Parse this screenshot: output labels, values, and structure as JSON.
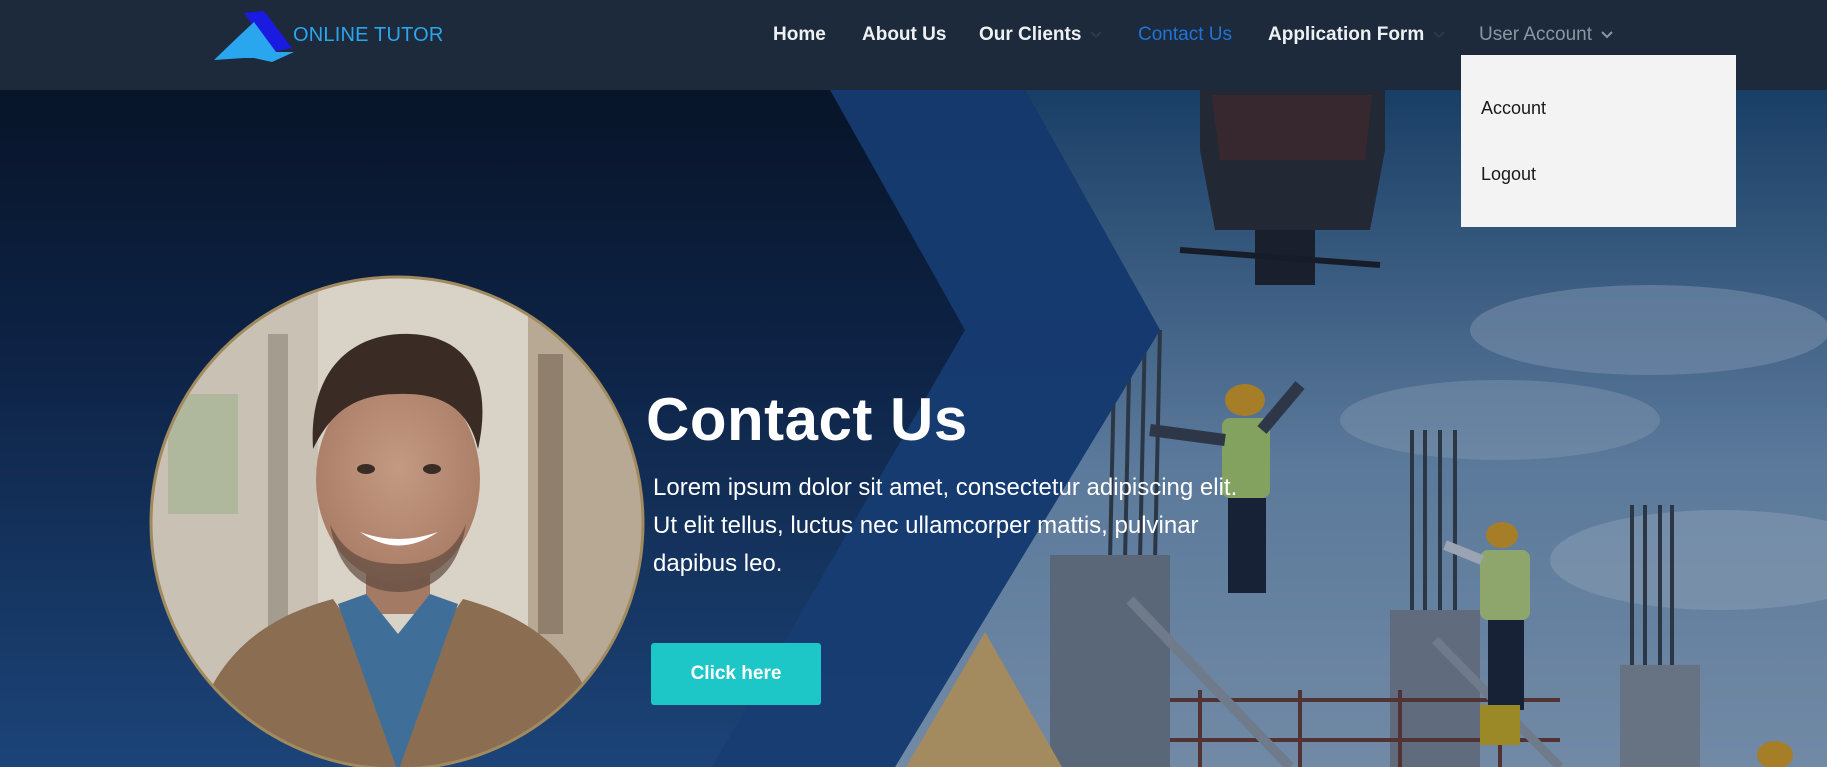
{
  "brand": {
    "name": "ONLINE TUTOR"
  },
  "nav": {
    "items": [
      {
        "label": "Home"
      },
      {
        "label": "About Us"
      },
      {
        "label": "Our Clients"
      },
      {
        "label": "Contact Us"
      },
      {
        "label": "Application Form"
      },
      {
        "label": "User Account"
      }
    ]
  },
  "user_menu": {
    "items": [
      {
        "label": "Account"
      },
      {
        "label": "Logout"
      }
    ]
  },
  "hero": {
    "title": "Contact Us",
    "description": "Lorem ipsum dolor sit amet, consectetur adipiscing elit. Ut elit tellus, luctus nec ullamcorper mattis, pulvinar dapibus leo.",
    "cta_label": "Click here"
  },
  "icons": {
    "logo": "logo-icon",
    "dropdown": "chevron-down-icon"
  },
  "colors": {
    "navbar": "#1d2a3b",
    "active_link": "#1e74d8",
    "brand_text": "#2aa6ee",
    "cta": "#1ec7c7",
    "accent_gold": "#a08a5e",
    "dropdown_bg": "#f3f3f3"
  }
}
